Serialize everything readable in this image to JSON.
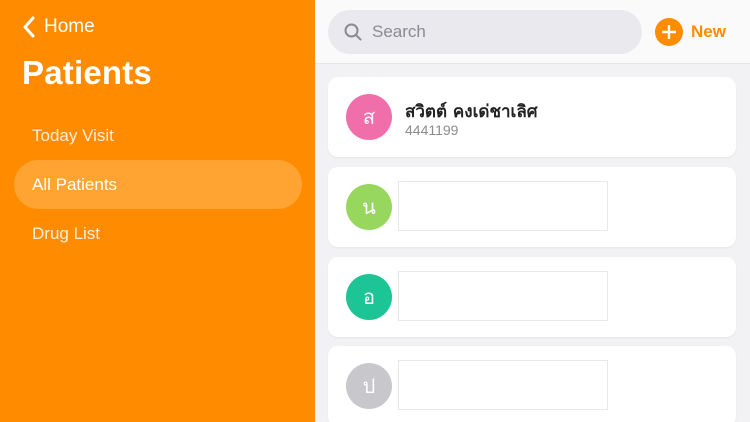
{
  "sidebar": {
    "back_label": "Home",
    "title": "Patients",
    "items": [
      {
        "label": "Today Visit",
        "active": false
      },
      {
        "label": "All Patients",
        "active": true
      },
      {
        "label": "Drug List",
        "active": false
      }
    ],
    "color": "#ff8c00"
  },
  "search": {
    "placeholder": "Search",
    "value": ""
  },
  "toolbar": {
    "new_label": "New",
    "accent": "#ff8c00"
  },
  "patients": [
    {
      "initial": "ส",
      "name": "สวิตต์ คงเด่ชาเลิศ",
      "id": "4441199",
      "color": "#f06eaa"
    },
    {
      "initial": "น",
      "name": "",
      "id": "",
      "color": "#98d75e"
    },
    {
      "initial": "อ",
      "name": "",
      "id": "",
      "color": "#1dc495"
    },
    {
      "initial": "ป",
      "name": "",
      "id": "",
      "color": "#c7c7cc"
    }
  ]
}
